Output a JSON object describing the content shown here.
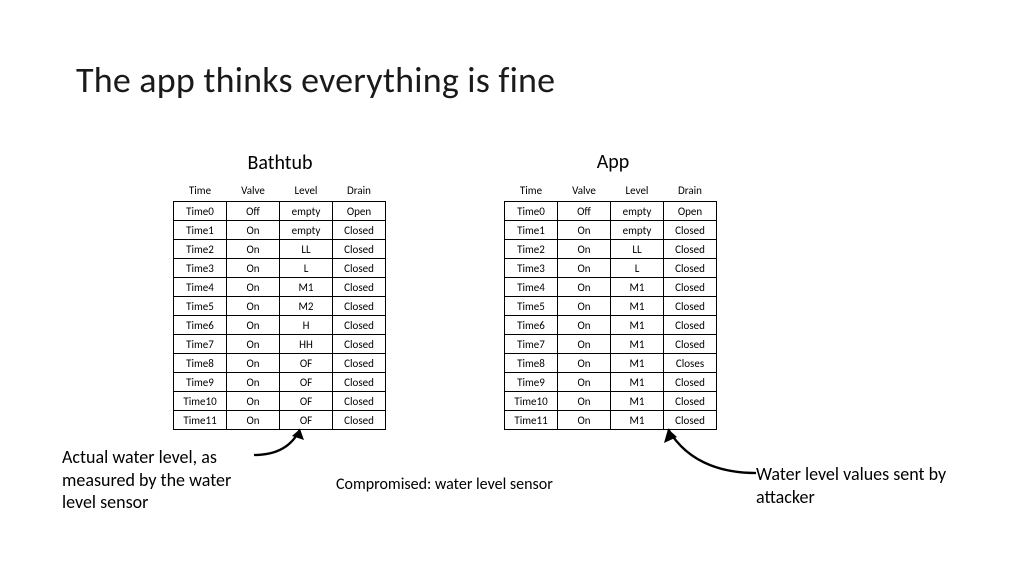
{
  "title": "The app thinks everything is fine",
  "subhead_bathtub": "Bathtub",
  "subhead_app": "App",
  "columns": [
    "Time",
    "Valve",
    "Level",
    "Drain"
  ],
  "bathtub_rows": [
    [
      "Time0",
      "Off",
      "empty",
      "Open"
    ],
    [
      "Time1",
      "On",
      "empty",
      "Closed"
    ],
    [
      "Time2",
      "On",
      "LL",
      "Closed"
    ],
    [
      "Time3",
      "On",
      "L",
      "Closed"
    ],
    [
      "Time4",
      "On",
      "M1",
      "Closed"
    ],
    [
      "Time5",
      "On",
      "M2",
      "Closed"
    ],
    [
      "Time6",
      "On",
      "H",
      "Closed"
    ],
    [
      "Time7",
      "On",
      "HH",
      "Closed"
    ],
    [
      "Time8",
      "On",
      "OF",
      "Closed"
    ],
    [
      "Time9",
      "On",
      "OF",
      "Closed"
    ],
    [
      "Time10",
      "On",
      "OF",
      "Closed"
    ],
    [
      "Time11",
      "On",
      "OF",
      "Closed"
    ]
  ],
  "app_rows": [
    [
      "Time0",
      "Off",
      "empty",
      "Open"
    ],
    [
      "Time1",
      "On",
      "empty",
      "Closed"
    ],
    [
      "Time2",
      "On",
      "LL",
      "Closed"
    ],
    [
      "Time3",
      "On",
      "L",
      "Closed"
    ],
    [
      "Time4",
      "On",
      "M1",
      "Closed"
    ],
    [
      "Time5",
      "On",
      "M1",
      "Closed"
    ],
    [
      "Time6",
      "On",
      "M1",
      "Closed"
    ],
    [
      "Time7",
      "On",
      "M1",
      "Closed"
    ],
    [
      "Time8",
      "On",
      "M1",
      "Closes"
    ],
    [
      "Time9",
      "On",
      "M1",
      "Closed"
    ],
    [
      "Time10",
      "On",
      "M1",
      "Closed"
    ],
    [
      "Time11",
      "On",
      "M1",
      "Closed"
    ]
  ],
  "caption_left": "Actual water level, as measured by the water level sensor",
  "caption_mid": "Compromised: water level sensor",
  "caption_right": "Water level values sent by attacker"
}
